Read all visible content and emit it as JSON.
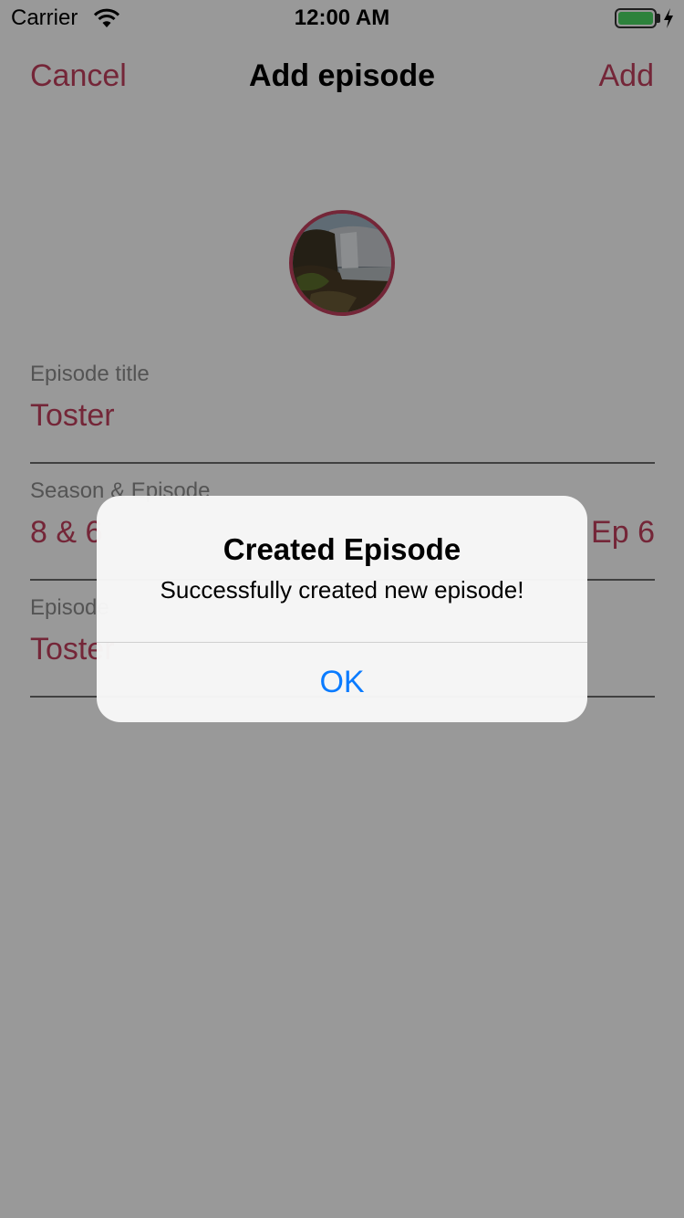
{
  "status_bar": {
    "carrier": "Carrier",
    "time": "12:00 AM",
    "battery_level": 1.0,
    "battery_color": "#4cd964"
  },
  "nav": {
    "cancel_label": "Cancel",
    "title": "Add episode",
    "add_label": "Add",
    "accent_color": "#c2405e"
  },
  "form": {
    "fields": [
      {
        "label": "Episode title",
        "value": "Toster"
      },
      {
        "label": "Season & Episode",
        "value": "8 & 6",
        "value_right": "Ep 6"
      },
      {
        "label": "Episode",
        "value": "Toster"
      }
    ]
  },
  "alert": {
    "title": "Created Episode",
    "message": "Successfully created new episode!",
    "ok_label": "OK",
    "button_color": "#0a7bff"
  }
}
